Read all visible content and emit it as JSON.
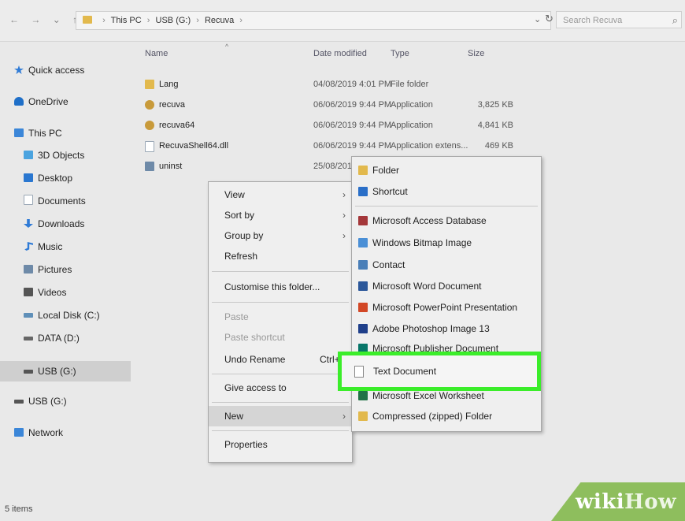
{
  "nav": {
    "back": "←",
    "forward": "→",
    "recent": "⌄",
    "up": "↑"
  },
  "address": {
    "segments": [
      "This PC",
      "USB (G:)",
      "Recuva"
    ],
    "separator": "›"
  },
  "address_dropdown": "⌄",
  "refresh_glyph": "↻",
  "search": {
    "placeholder": "Search Recuva",
    "icon_glyph": "⌕"
  },
  "sidebar": {
    "items": [
      {
        "label": "Quick access",
        "icon": "star-icon",
        "color": "#2f7bd6"
      },
      {
        "label": "OneDrive",
        "icon": "cloud-icon",
        "color": "#1f6fc8"
      },
      {
        "label": "This PC",
        "icon": "computer-icon",
        "color": "#3b86d8"
      },
      {
        "label": "3D Objects",
        "icon": "cube-icon",
        "color": "#4aa3df"
      },
      {
        "label": "Desktop",
        "icon": "desktop-icon",
        "color": "#2a77d0"
      },
      {
        "label": "Documents",
        "icon": "document-icon",
        "color": "#9aa7b5"
      },
      {
        "label": "Downloads",
        "icon": "download-icon",
        "color": "#2f7bd6"
      },
      {
        "label": "Music",
        "icon": "music-icon",
        "color": "#2f7bd6"
      },
      {
        "label": "Pictures",
        "icon": "pictures-icon",
        "color": "#6e8aa8"
      },
      {
        "label": "Videos",
        "icon": "video-icon",
        "color": "#555"
      },
      {
        "label": "Local Disk (C:)",
        "icon": "drive-icon",
        "color": "#5f8fb8"
      },
      {
        "label": "DATA (D:)",
        "icon": "drive-icon",
        "color": "#666"
      },
      {
        "label": "USB (G:)",
        "icon": "usb-drive-icon",
        "color": "#555"
      },
      {
        "label": "USB (G:)",
        "icon": "usb-drive-icon",
        "color": "#555"
      },
      {
        "label": "Network",
        "icon": "network-icon",
        "color": "#3b86d8"
      }
    ]
  },
  "columns": {
    "name": "Name",
    "date": "Date modified",
    "type": "Type",
    "size": "Size"
  },
  "files": [
    {
      "name": "Lang",
      "date": "04/08/2019 4:01 PM",
      "type": "File folder",
      "size": "",
      "icon": "folder-icon",
      "color": "#e2b94d"
    },
    {
      "name": "recuva",
      "date": "06/06/2019 9:44 PM",
      "type": "Application",
      "size": "3,825 KB",
      "icon": "app-icon",
      "color": "#c89a3a"
    },
    {
      "name": "recuva64",
      "date": "06/06/2019 9:44 PM",
      "type": "Application",
      "size": "4,841 KB",
      "icon": "app-icon",
      "color": "#c89a3a"
    },
    {
      "name": "RecuvaShell64.dll",
      "date": "06/06/2019 9:44 PM",
      "type": "Application extens...",
      "size": "469 KB",
      "icon": "dll-icon",
      "color": "#9aa7b5"
    },
    {
      "name": "uninst",
      "date": "25/08/201",
      "type": "",
      "size": "",
      "icon": "installer-icon",
      "color": "#6e8aa8"
    }
  ],
  "context_menu": {
    "view": "View",
    "sort_by": "Sort by",
    "group_by": "Group by",
    "refresh": "Refresh",
    "customise": "Customise this folder...",
    "paste": "Paste",
    "paste_shortcut": "Paste shortcut",
    "undo_rename": "Undo Rename",
    "undo_shortcut": "Ctrl+Z",
    "give_access": "Give access to",
    "new": "New",
    "properties": "Properties",
    "arrow": "›"
  },
  "submenu": {
    "items": [
      {
        "label": "Folder",
        "icon": "folder-icon",
        "color": "#e2b94d"
      },
      {
        "label": "Shortcut",
        "icon": "shortcut-icon",
        "color": "#2a6fc8"
      },
      {
        "label": "Microsoft Access Database",
        "icon": "access-icon",
        "color": "#a4373a"
      },
      {
        "label": "Windows Bitmap Image",
        "icon": "bitmap-icon",
        "color": "#4a8fd6"
      },
      {
        "label": "Contact",
        "icon": "contact-icon",
        "color": "#4a7fb8"
      },
      {
        "label": "Microsoft Word Document",
        "icon": "word-icon",
        "color": "#2b579a"
      },
      {
        "label": "Microsoft PowerPoint Presentation",
        "icon": "powerpoint-icon",
        "color": "#d24726"
      },
      {
        "label": "Adobe Photoshop Image 13",
        "icon": "photoshop-icon",
        "color": "#1f3f8a"
      },
      {
        "label": "Microsoft Publisher Document",
        "icon": "publisher-icon",
        "color": "#077568"
      },
      {
        "label": "Text Document",
        "icon": "text-document-icon",
        "color": "#ffffff"
      },
      {
        "label": "Microsoft Excel Worksheet",
        "icon": "excel-icon",
        "color": "#217346"
      },
      {
        "label": "Compressed (zipped) Folder",
        "icon": "zip-folder-icon",
        "color": "#e2b94d"
      }
    ]
  },
  "status": {
    "items": "5 items"
  },
  "watermark": {
    "wiki": "wiki",
    "how": "How"
  },
  "colors": {
    "highlight": "#3bed2a",
    "watermark_bg": "#8ebe5d"
  }
}
